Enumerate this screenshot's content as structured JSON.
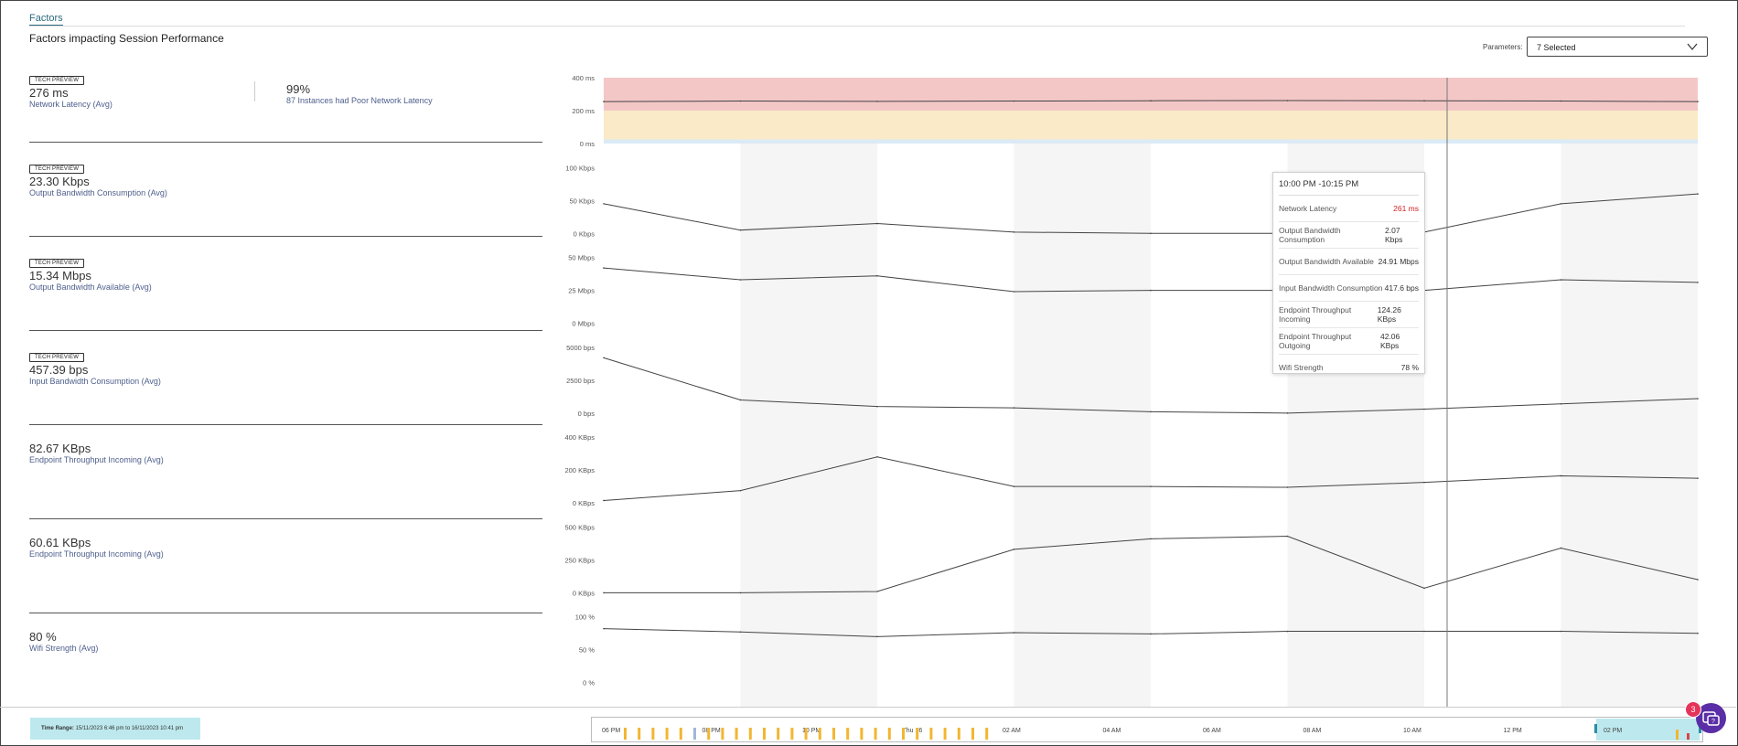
{
  "tabs": [
    {
      "label": "Factors",
      "active": true
    }
  ],
  "page_title": "Factors impacting Session Performance",
  "parameters": {
    "label": "Parameters:",
    "selected": "7 Selected"
  },
  "metrics": [
    {
      "badge": "TECH PREVIEW",
      "value": "276 ms",
      "label": "Network Latency (Avg)",
      "secondary_value": "99%",
      "secondary_label": "87 Instances had Poor Network Latency"
    },
    {
      "badge": "TECH PREVIEW",
      "value": "23.30 Kbps",
      "label": "Output Bandwidth Consumption (Avg)"
    },
    {
      "badge": "TECH PREVIEW",
      "value": "15.34 Mbps",
      "label": "Output Bandwidth Available (Avg)"
    },
    {
      "badge": "TECH PREVIEW",
      "value": "457.39 bps",
      "label": "Input Bandwidth Consumption (Avg)"
    },
    {
      "value": "82.67 KBps",
      "label": "Endpoint Throughput Incoming (Avg)"
    },
    {
      "value": "60.61 KBps",
      "label": "Endpoint Throughput Incoming (Avg)"
    },
    {
      "value": "80 %",
      "label": "Wifi Strength (Avg)"
    }
  ],
  "colors": {
    "band_poor": "#f4c7c7",
    "band_fair": "#faeac7",
    "band_good": "#dbeaf5",
    "line": "#444444",
    "shade": "#f5f5f5",
    "accent": "#2a6a7e",
    "tooltip_alert": "#d22222",
    "timeline_bar": "#f2b632",
    "help": "#5a2ea6"
  },
  "chart_data": [
    {
      "type": "line",
      "name": "Network Latency",
      "yticks": [
        "400 ms",
        "200 ms",
        "0 ms"
      ],
      "ylim": [
        0,
        400
      ],
      "values": [
        255,
        258,
        256,
        258,
        260,
        261,
        260,
        258,
        255
      ],
      "bands": [
        {
          "from": 200,
          "to": 400,
          "level": "poor"
        },
        {
          "from": 25,
          "to": 200,
          "level": "fair"
        },
        {
          "from": 0,
          "to": 25,
          "level": "good"
        }
      ]
    },
    {
      "type": "line",
      "name": "Output Bandwidth Consumption",
      "yticks": [
        "100 Kbps",
        "50 Kbps",
        "0 Kbps"
      ],
      "ylim": [
        0,
        100
      ],
      "values": [
        45,
        5,
        15,
        2,
        0,
        0,
        2,
        45,
        60
      ]
    },
    {
      "type": "line",
      "name": "Output Bandwidth Available",
      "yticks": [
        "50 Mbps",
        "25 Mbps",
        "0 Mbps"
      ],
      "ylim": [
        0,
        50
      ],
      "values": [
        42,
        33,
        36,
        24,
        25,
        25,
        25,
        33,
        31
      ]
    },
    {
      "type": "line",
      "name": "Input Bandwidth Consumption",
      "yticks": [
        "5000 bps",
        "2500 bps",
        "0 bps"
      ],
      "ylim": [
        0,
        5000
      ],
      "values": [
        4200,
        1000,
        500,
        400,
        100,
        0,
        300,
        700,
        1100
      ]
    },
    {
      "type": "line",
      "name": "Endpoint Throughput Incoming",
      "yticks": [
        "400 KBps",
        "200 KBps",
        "0 KBps"
      ],
      "ylim": [
        0,
        400
      ],
      "values": [
        15,
        75,
        280,
        100,
        100,
        95,
        125,
        165,
        150
      ]
    },
    {
      "type": "line",
      "name": "Endpoint Throughput Outgoing",
      "yticks": [
        "500 KBps",
        "250 KBps",
        "0 KBps"
      ],
      "ylim": [
        0,
        500
      ],
      "values": [
        0,
        0,
        10,
        330,
        410,
        430,
        35,
        340,
        100
      ]
    },
    {
      "type": "line",
      "name": "Wifi Strength",
      "yticks": [
        "100 %",
        "50 %",
        "0 %"
      ],
      "ylim": [
        0,
        100
      ],
      "values": [
        82,
        77,
        70,
        76,
        74,
        78,
        78,
        78,
        75
      ]
    }
  ],
  "tooltip": {
    "time": "10:00 PM -10:15 PM",
    "rows": [
      {
        "label": "Network Latency",
        "value": "261 ms",
        "alert": true
      },
      {
        "label": "Output Bandwidth Consumption",
        "value": "2.07 Kbps"
      },
      {
        "label": "Output Bandwidth Available",
        "value": "24.91 Mbps"
      },
      {
        "label": "Input Bandwidth Consumption",
        "value": "417.6 bps"
      },
      {
        "label": "Endpoint Throughput Incoming",
        "value": "124.26 KBps"
      },
      {
        "label": "Endpoint Throughput Outgoing",
        "value": "42.06 KBps"
      },
      {
        "label": "Wifi Strength",
        "value": "78 %"
      }
    ]
  },
  "timeline": {
    "ticks": [
      "06 PM",
      "08 PM",
      "10 PM",
      "Thu 16",
      "02 AM",
      "04 AM",
      "06 AM",
      "08 AM",
      "10 AM",
      "12 PM",
      "02 PM"
    ],
    "bars": [
      1,
      1,
      1,
      1,
      1,
      0,
      1,
      1,
      1,
      1,
      1,
      1,
      1,
      1,
      1,
      1,
      1,
      1,
      1,
      1,
      1,
      1,
      1,
      1,
      1,
      1,
      1
    ]
  },
  "time_range": {
    "label": "Time Range:",
    "value": "15/11/2023 6:46 pm to 16/11/2023 10:41 pm"
  },
  "help": {
    "badge": "3"
  }
}
